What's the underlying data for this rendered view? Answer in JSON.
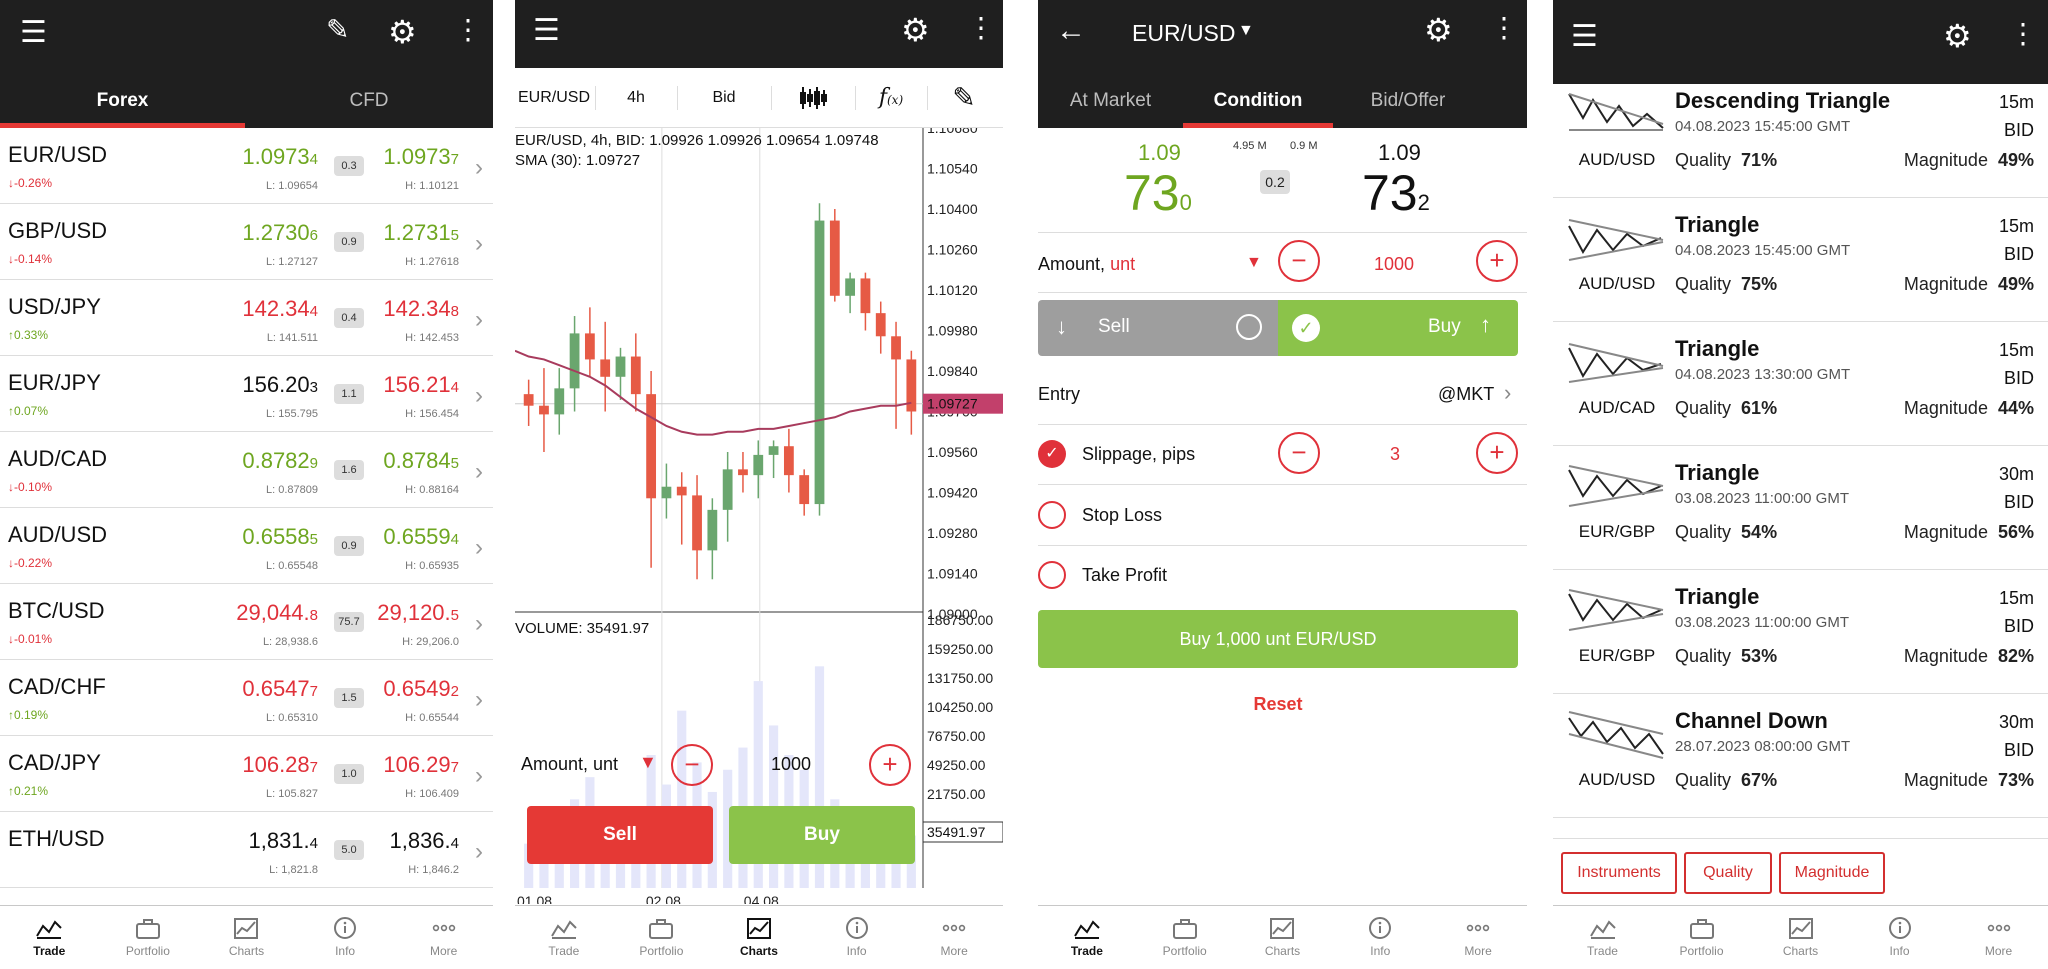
{
  "s1": {
    "tabs": [
      "Forex",
      "CFD"
    ],
    "rows": [
      {
        "sym": "EUR/USD",
        "chg": "-0.26%",
        "dir": "down",
        "bid_main": "1.0973",
        "bid_sub": "4",
        "ask_main": "1.0973",
        "ask_sub": "7",
        "spread": "0.3",
        "low": "L: 1.09654",
        "high": "H: 1.10121",
        "color": "green"
      },
      {
        "sym": "GBP/USD",
        "chg": "-0.14%",
        "dir": "down",
        "bid_main": "1.2730",
        "bid_sub": "6",
        "ask_main": "1.2731",
        "ask_sub": "5",
        "spread": "0.9",
        "low": "L: 1.27127",
        "high": "H: 1.27618",
        "color": "green"
      },
      {
        "sym": "USD/JPY",
        "chg": "0.33%",
        "dir": "up",
        "bid_main": "142.34",
        "bid_sub": "4",
        "ask_main": "142.34",
        "ask_sub": "8",
        "spread": "0.4",
        "low": "L: 141.511",
        "high": "H: 142.453",
        "color": "red"
      },
      {
        "sym": "EUR/JPY",
        "chg": "0.07%",
        "dir": "up",
        "bid_main": "156.20",
        "bid_sub": "3",
        "ask_main": "156.21",
        "ask_sub": "4",
        "spread": "1.1",
        "low": "L: 155.795",
        "high": "H: 156.454",
        "color": "mixed"
      },
      {
        "sym": "AUD/CAD",
        "chg": "-0.10%",
        "dir": "down",
        "bid_main": "0.8782",
        "bid_sub": "9",
        "ask_main": "0.8784",
        "ask_sub": "5",
        "spread": "1.6",
        "low": "L: 0.87809",
        "high": "H: 0.88164",
        "color": "green"
      },
      {
        "sym": "AUD/USD",
        "chg": "-0.22%",
        "dir": "down",
        "bid_main": "0.6558",
        "bid_sub": "5",
        "ask_main": "0.6559",
        "ask_sub": "4",
        "spread": "0.9",
        "low": "L: 0.65548",
        "high": "H: 0.65935",
        "color": "green"
      },
      {
        "sym": "BTC/USD",
        "chg": "-0.01%",
        "dir": "down",
        "bid_main": "29,044.",
        "bid_sub": "8",
        "ask_main": "29,120.",
        "ask_sub": "5",
        "spread": "75.7",
        "low": "L: 28,938.6",
        "high": "H: 29,206.0",
        "color": "red"
      },
      {
        "sym": "CAD/CHF",
        "chg": "0.19%",
        "dir": "up",
        "bid_main": "0.6547",
        "bid_sub": "7",
        "ask_main": "0.6549",
        "ask_sub": "2",
        "spread": "1.5",
        "low": "L: 0.65310",
        "high": "H: 0.65544",
        "color": "red"
      },
      {
        "sym": "CAD/JPY",
        "chg": "0.21%",
        "dir": "up",
        "bid_main": "106.28",
        "bid_sub": "7",
        "ask_main": "106.29",
        "ask_sub": "7",
        "spread": "1.0",
        "low": "L: 105.827",
        "high": "H: 106.409",
        "color": "red"
      },
      {
        "sym": "ETH/USD",
        "chg": "",
        "dir": "",
        "bid_main": "1,831.",
        "bid_sub": "4",
        "ask_main": "1,836.",
        "ask_sub": "4",
        "spread": "5.0",
        "low": "L: 1,821.8",
        "high": "H: 1,846.2",
        "color": "dark"
      }
    ]
  },
  "nav": [
    "Trade",
    "Portfolio",
    "Charts",
    "Info",
    "More"
  ],
  "s2": {
    "toolbar": {
      "symbol": "EUR/USD",
      "tf": "4h",
      "side": "Bid"
    },
    "info1": "EUR/USD, 4h, BID: 1.09926 1.09926 1.09654 1.09748",
    "info2": "SMA (30): 1.09727",
    "volume_label": "VOLUME: 35491.97",
    "current_price": "1.09727",
    "current_volume": "35491.97",
    "amount_label": "Amount, unt",
    "amount": "1000",
    "sell": "Sell",
    "buy": "Buy"
  },
  "chart_data": {
    "type": "candlestick",
    "title": "EUR/USD, 4h, BID: 1.09926 1.09926 1.09654 1.09748",
    "yticks": [
      "1.10680",
      "1.10540",
      "1.10400",
      "1.10260",
      "1.10120",
      "1.09980",
      "1.09840",
      "1.09700",
      "1.09560",
      "1.09420",
      "1.09280",
      "1.09140",
      "1.09000"
    ],
    "vticks": [
      "186750.00",
      "159250.00",
      "131750.00",
      "104250.00",
      "76750.00",
      "49250.00",
      "21750.00"
    ],
    "xticks": [
      "01.08",
      "02.08",
      "04.08"
    ],
    "ylim": [
      1.09,
      1.1068
    ],
    "candles": [
      {
        "o": 1.0976,
        "h": 1.0981,
        "l": 1.0965,
        "c": 1.0972
      },
      {
        "o": 1.0972,
        "h": 1.0985,
        "l": 1.0956,
        "c": 1.0969
      },
      {
        "o": 1.0969,
        "h": 1.0985,
        "l": 1.0962,
        "c": 1.0978
      },
      {
        "o": 1.0978,
        "h": 1.1003,
        "l": 1.097,
        "c": 1.0997
      },
      {
        "o": 1.0997,
        "h": 1.1006,
        "l": 1.0982,
        "c": 1.0988
      },
      {
        "o": 1.0988,
        "h": 1.1001,
        "l": 1.097,
        "c": 1.0982
      },
      {
        "o": 1.0982,
        "h": 1.0992,
        "l": 1.0974,
        "c": 1.0989
      },
      {
        "o": 1.0989,
        "h": 1.0997,
        "l": 1.097,
        "c": 1.0976
      },
      {
        "o": 1.0976,
        "h": 1.0984,
        "l": 1.0916,
        "c": 1.094
      },
      {
        "o": 1.094,
        "h": 1.0952,
        "l": 1.0933,
        "c": 1.0944
      },
      {
        "o": 1.0944,
        "h": 1.0949,
        "l": 1.0924,
        "c": 1.0941
      },
      {
        "o": 1.0941,
        "h": 1.0948,
        "l": 1.0912,
        "c": 1.0922
      },
      {
        "o": 1.0922,
        "h": 1.094,
        "l": 1.0912,
        "c": 1.0936
      },
      {
        "o": 1.0936,
        "h": 1.0956,
        "l": 1.0925,
        "c": 1.095
      },
      {
        "o": 1.095,
        "h": 1.0956,
        "l": 1.0942,
        "c": 1.0948
      },
      {
        "o": 1.0948,
        "h": 1.096,
        "l": 1.094,
        "c": 1.0955
      },
      {
        "o": 1.0955,
        "h": 1.096,
        "l": 1.0947,
        "c": 1.0958
      },
      {
        "o": 1.0958,
        "h": 1.0964,
        "l": 1.0942,
        "c": 1.0948
      },
      {
        "o": 1.0948,
        "h": 1.095,
        "l": 1.0934,
        "c": 1.0938
      },
      {
        "o": 1.0938,
        "h": 1.1042,
        "l": 1.0934,
        "c": 1.1036
      },
      {
        "o": 1.1036,
        "h": 1.104,
        "l": 1.1008,
        "c": 1.101
      },
      {
        "o": 1.101,
        "h": 1.1018,
        "l": 1.1004,
        "c": 1.1016
      },
      {
        "o": 1.1016,
        "h": 1.1018,
        "l": 1.0998,
        "c": 1.1004
      },
      {
        "o": 1.1004,
        "h": 1.1008,
        "l": 1.099,
        "c": 1.0996
      },
      {
        "o": 1.0996,
        "h": 1.1001,
        "l": 1.0964,
        "c": 1.0988
      },
      {
        "o": 1.0988,
        "h": 1.0991,
        "l": 1.0962,
        "c": 1.097
      }
    ],
    "sma": [
      1.0989,
      1.0988,
      1.0986,
      1.0984,
      1.0982,
      1.0979,
      1.0975,
      1.0971,
      1.0968,
      1.0965,
      1.0963,
      1.0962,
      1.0962,
      1.0963,
      1.0963,
      1.0964,
      1.0964,
      1.0965,
      1.0966,
      1.0967,
      1.0968,
      1.097,
      1.0971,
      1.0972,
      1.0972,
      1.0973
    ],
    "volumes": [
      30000,
      45000,
      40000,
      60000,
      75000,
      55000,
      40000,
      50000,
      90000,
      70000,
      120000,
      85000,
      65000,
      80000,
      95000,
      140000,
      110000,
      90000,
      80000,
      150000,
      60000,
      50000,
      45000,
      40000,
      35000,
      35491.97
    ]
  },
  "s3": {
    "title": "EUR/USD",
    "tabs": [
      "At Market",
      "Condition",
      "Bid/Offer"
    ],
    "bid_top": "1.09",
    "bid_big": "73",
    "bid_sub": "0",
    "ask_top": "1.09",
    "ask_big": "73",
    "ask_sub": "2",
    "vol_left": "4.95 M",
    "vol_right": "0.9 M",
    "spread": "0.2",
    "amount_label": "Amount,",
    "amount_unit": "unt",
    "amount": "1000",
    "sell": "Sell",
    "buy": "Buy",
    "entry_label": "Entry",
    "entry_value": "@MKT",
    "slippage_label": "Slippage, pips",
    "slippage": "3",
    "stop_loss": "Stop Loss",
    "take_profit": "Take Profit",
    "submit": "Buy 1,000 unt EUR/USD",
    "reset": "Reset"
  },
  "s4": {
    "patterns": [
      {
        "name": "Descending Triangle",
        "date": "04.08.2023 15:45:00 GMT",
        "tf": "15m",
        "side": "BID",
        "inst": "AUD/USD",
        "quality": "71%",
        "magnitude": "49%"
      },
      {
        "name": "Triangle",
        "date": "04.08.2023 15:45:00 GMT",
        "tf": "15m",
        "side": "BID",
        "inst": "AUD/USD",
        "quality": "75%",
        "magnitude": "49%"
      },
      {
        "name": "Triangle",
        "date": "04.08.2023 13:30:00 GMT",
        "tf": "15m",
        "side": "BID",
        "inst": "AUD/CAD",
        "quality": "61%",
        "magnitude": "44%"
      },
      {
        "name": "Triangle",
        "date": "03.08.2023 11:00:00 GMT",
        "tf": "30m",
        "side": "BID",
        "inst": "EUR/GBP",
        "quality": "54%",
        "magnitude": "56%"
      },
      {
        "name": "Triangle",
        "date": "03.08.2023 11:00:00 GMT",
        "tf": "15m",
        "side": "BID",
        "inst": "EUR/GBP",
        "quality": "53%",
        "magnitude": "82%"
      },
      {
        "name": "Channel Down",
        "date": "28.07.2023 08:00:00 GMT",
        "tf": "30m",
        "side": "BID",
        "inst": "AUD/USD",
        "quality": "67%",
        "magnitude": "73%"
      }
    ],
    "quality_label": "Quality",
    "magnitude_label": "Magnitude",
    "filters": [
      "Instruments",
      "Quality",
      "Magnitude"
    ]
  },
  "colors": {
    "bar": "#1f1f1f",
    "accent": "#e53935",
    "green": "#8bc34a",
    "red": "#e0313a",
    "sell_gray": "#9e9e9e"
  }
}
